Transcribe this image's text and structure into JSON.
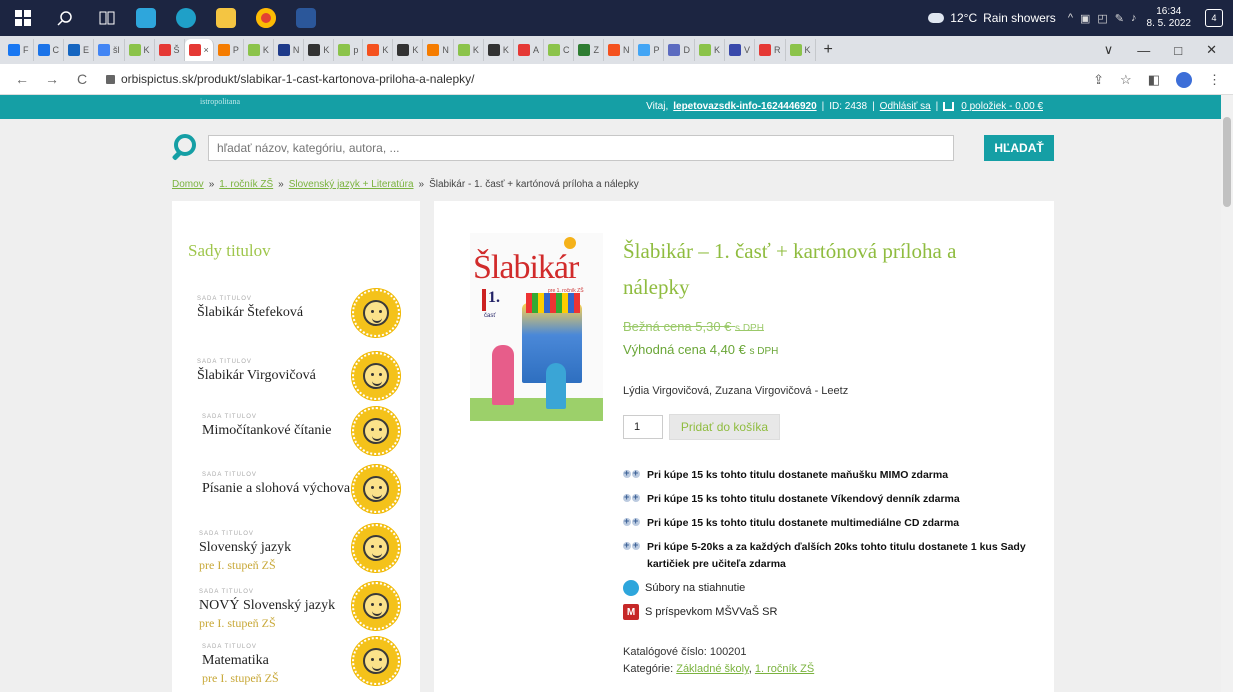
{
  "taskbar": {
    "weather_temp": "12°C",
    "weather_text": "Rain showers",
    "time": "16:34",
    "date": "8. 5. 2022",
    "notifications": "4",
    "tray_arrow": "^",
    "apps": [
      {
        "name": "windows-icon",
        "color": "#ffffff"
      },
      {
        "name": "search-icon",
        "color": "#ffffff"
      },
      {
        "name": "task-view-icon",
        "color": "#ffffff"
      },
      {
        "name": "files-app-icon",
        "color": "#2ea6dc"
      },
      {
        "name": "edge-icon",
        "color": "#1fa0c8"
      },
      {
        "name": "file-explorer-icon",
        "color": "#f4c542"
      },
      {
        "name": "chrome-icon",
        "color": "#e34133"
      },
      {
        "name": "word-icon",
        "color": "#2b579a"
      }
    ]
  },
  "browser": {
    "tabs": [
      {
        "label": "F",
        "color": "#1877f2"
      },
      {
        "label": "C",
        "color": "#1a73e8"
      },
      {
        "label": "E",
        "color": "#1565c0"
      },
      {
        "label": "šl",
        "color": "#4285f4"
      },
      {
        "label": "K",
        "color": "#8bc34a"
      },
      {
        "label": "Š",
        "color": "#e53935"
      },
      {
        "label": "×",
        "color": "#e53935"
      },
      {
        "label": "P",
        "color": "#f57c00"
      },
      {
        "label": "K",
        "color": "#8bc34a"
      },
      {
        "label": "N",
        "color": "#1e3a8a"
      },
      {
        "label": "K",
        "color": "#333333"
      },
      {
        "label": "p",
        "color": "#8bc34a"
      },
      {
        "label": "K",
        "color": "#f4511e"
      },
      {
        "label": "K",
        "color": "#333333"
      },
      {
        "label": "N",
        "color": "#f57c00"
      },
      {
        "label": "K",
        "color": "#8bc34a"
      },
      {
        "label": "K",
        "color": "#333333"
      },
      {
        "label": "A",
        "color": "#e53935"
      },
      {
        "label": "C",
        "color": "#8bc34a"
      },
      {
        "label": "Z",
        "color": "#2e7d32"
      },
      {
        "label": "N",
        "color": "#f4511e"
      },
      {
        "label": "P",
        "color": "#42a5f5"
      },
      {
        "label": "D",
        "color": "#5c6bc0"
      },
      {
        "label": "K",
        "color": "#8bc34a"
      },
      {
        "label": "V",
        "color": "#3949ab"
      },
      {
        "label": "R",
        "color": "#e53935"
      },
      {
        "label": "K",
        "color": "#8bc34a"
      }
    ],
    "new_tab": "+",
    "url": "orbispictus.sk/produkt/slabikar-1-cast-kartonova-priloha-a-nalepky/",
    "back": "←",
    "forward": "→",
    "reload": "C",
    "win_dropdown": "∨",
    "win_min": "—",
    "win_max": "□",
    "win_close": "✕",
    "share": "⇪",
    "star": "☆",
    "sidepanel": "◧",
    "menu": "⋮"
  },
  "site": {
    "brand": "istropolitana",
    "user": {
      "greeting": "Vitaj,",
      "username": "lepetovazsdk-info-1624446920",
      "id_label": "ID: 2438",
      "sep": "|",
      "logout": "Odhlásiť sa",
      "cart": "0 položiek - 0,00 €"
    },
    "search": {
      "placeholder": "hľadať názov, kategóriu, autora, ...",
      "button": "HĽADAŤ"
    },
    "breadcrumb": {
      "home": "Domov",
      "sep": "»",
      "level1": "1. ročník ZŠ",
      "level2": "Slovenský jazyk + Literatúra",
      "current": "Šlabikár - 1. časť + kartónová príloha a nálepky"
    },
    "sidebar": {
      "title": "Sady titulov",
      "tag": "SADA TITULOV",
      "sets": [
        {
          "name": "Šlabikár Štefeková",
          "sub": ""
        },
        {
          "name": "Šlabikár Virgovičová",
          "sub": ""
        },
        {
          "name": "Mimočítankové čítanie",
          "sub": ""
        },
        {
          "name": "Písanie a slohová výchova",
          "sub": ""
        },
        {
          "name": "Slovenský jazyk",
          "sub": "pre I. stupeň ZŠ"
        },
        {
          "name": "NOVÝ Slovenský jazyk",
          "sub": "pre I. stupeň ZŠ"
        },
        {
          "name": "Matematika",
          "sub": "pre I. stupeň ZŠ"
        }
      ]
    },
    "product": {
      "cover_title": "Šlabikár",
      "cover_sub": "pre 1. ročník ZŠ",
      "cover_part": "1.",
      "cover_part_label": "časť",
      "title": "Šlabikár – 1. časť + kartónová príloha a nálepky",
      "old_price_label": "Bežná cena 5,30 €",
      "new_price_label": "Výhodná cena 4,40 €",
      "vat": "s DPH",
      "authors": "Lýdia Virgovičová, Zuzana Virgovičová - Leetz",
      "quantity": "1",
      "add_to_cart": "Pridať do košíka",
      "promos": [
        "Pri kúpe 15 ks tohto titulu dostanete maňušku MIMO zdarma",
        "Pri kúpe 15 ks tohto titulu dostanete Víkendový denník zdarma",
        "Pri kúpe 15 ks tohto titulu dostanete multimediálne CD zdarma",
        "Pri kúpe 5-20ks a za každých ďalších 20ks tohto titulu dostanete 1 kus Sady kartičiek pre učiteľa zdarma"
      ],
      "downloads": "Súbory na stiahnutie",
      "ministry": "S príspevkom MŠVVaŠ SR",
      "ministry_icon": "M",
      "catalog_label": "Katalógové číslo: 100201",
      "categories_label": "Kategórie:",
      "category1": "Základné školy",
      "category2": "1. ročník ZŠ"
    }
  }
}
